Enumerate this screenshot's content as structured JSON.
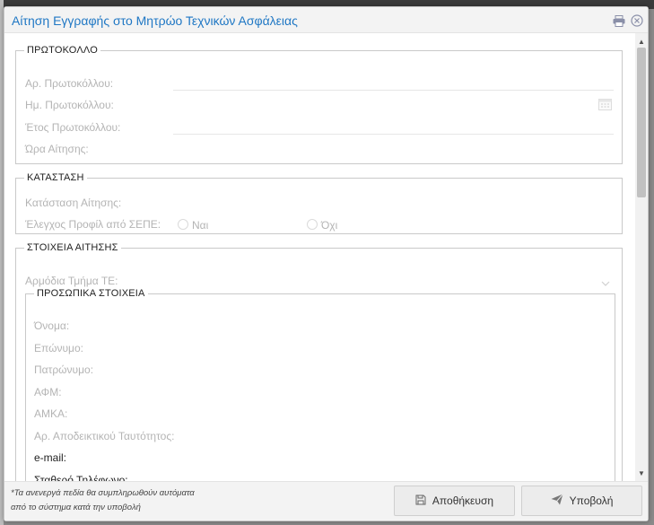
{
  "dialog": {
    "title": "Αίτηση Εγγραφής στο Μητρώο Τεχνικών Ασφάλειας",
    "print_icon": "printer-icon",
    "close_icon": "close-circle-icon"
  },
  "protocol": {
    "legend": "ΠΡΩΤΟΚΟΛΛΟ",
    "number_label": "Αρ. Πρωτοκόλλου:",
    "date_label": "Ημ. Πρωτοκόλλου:",
    "year_label": "Έτος Πρωτοκόλλου:",
    "time_label": "Ώρα Αίτησης:",
    "calendar_icon": "calendar-icon"
  },
  "status": {
    "legend": "ΚΑΤΑΣΤΑΣΗ",
    "status_label": "Κατάσταση Αίτησης:",
    "profile_check_label": "Έλεγχος Προφίλ από ΣΕΠΕ:",
    "yes_label": "Ναι",
    "no_label": "Όχι"
  },
  "application": {
    "legend": "ΣΤΟΙΧΕΙΑ ΑΙΤΗΣΗΣ",
    "department_label": "Αρμόδια Τμήμα ΤΕ:",
    "dropdown_icon": "chevron-down-icon"
  },
  "personal": {
    "legend": "ΠΡΟΣΩΠΙΚΑ ΣΤΟΙΧΕΙΑ",
    "first_name_label": "Όνομα:",
    "last_name_label": "Επώνυμο:",
    "father_name_label": "Πατρώνυμο:",
    "afm_label": "ΑΦΜ:",
    "amka_label": "ΑΜΚΑ:",
    "id_label": "Αρ. Αποδεικτικού Ταυτότητος:",
    "email_label": "e-mail:",
    "phone_label": "Σταθερό Τηλέφωνο:"
  },
  "footer": {
    "note_line1": "*Τα ανενεργά πεδία θα συμπληρωθούν αυτόματα",
    "note_line2": "από το σύστημα κατά την υποβολή",
    "save_label": "Αποθήκευση",
    "submit_label": "Υποβολή",
    "save_icon": "floppy-disk-icon",
    "submit_icon": "paper-plane-icon"
  }
}
